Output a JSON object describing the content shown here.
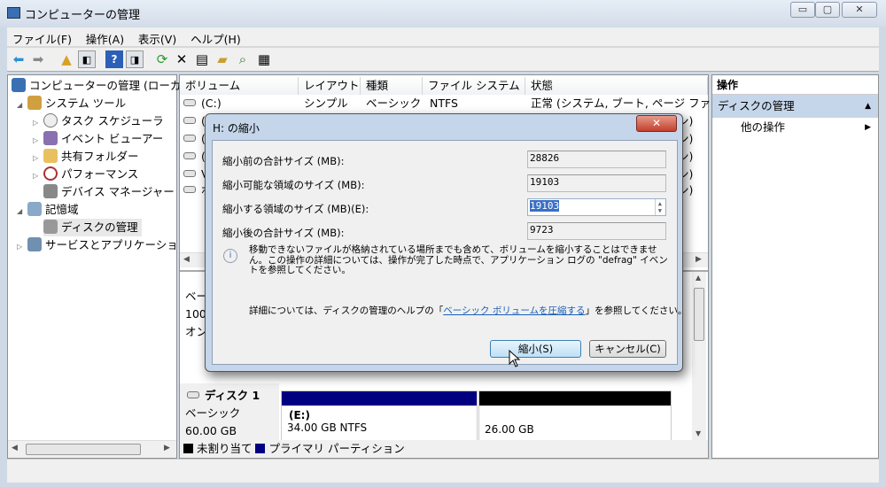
{
  "window": {
    "title": "コンピューターの管理",
    "minimize": "▭",
    "maximize": "▢",
    "close": "✕"
  },
  "menu": [
    "ファイル(F)",
    "操作(A)",
    "表示(V)",
    "ヘルプ(H)"
  ],
  "tree": [
    {
      "label": "コンピューターの管理 (ローカ",
      "expander": ""
    },
    {
      "label": "システム ツール",
      "expander": "◢"
    },
    {
      "label": "タスク スケジューラ",
      "expander": "▷"
    },
    {
      "label": "イベント ビューアー",
      "expander": "▷"
    },
    {
      "label": "共有フォルダー",
      "expander": "▷"
    },
    {
      "label": "パフォーマンス",
      "expander": "▷"
    },
    {
      "label": "デバイス マネージャー",
      "expander": ""
    },
    {
      "label": "記憶域",
      "expander": "◢"
    },
    {
      "label": "ディスクの管理",
      "expander": ""
    },
    {
      "label": "サービスとアプリケーショ",
      "expander": "▷"
    }
  ],
  "volumes": {
    "headers": [
      "ボリューム",
      "レイアウト",
      "種類",
      "ファイル システム",
      "状態"
    ],
    "rows": [
      {
        "volume": "(C:)",
        "layout": "シンプル",
        "type": "ベーシック",
        "fs": "NTFS",
        "status": "正常 (システム, ブート, ページ ファ"
      },
      {
        "volume": "(",
        "status": "ン)"
      },
      {
        "volume": "(",
        "status": "ン)"
      },
      {
        "volume": "(",
        "status": "ン)"
      },
      {
        "volume": "V",
        "status": "ン)"
      },
      {
        "volume": "ボ",
        "status": "ン)"
      }
    ]
  },
  "disk0": {
    "line1": "ベー",
    "line2": "100",
    "line3": "オン"
  },
  "disk1": {
    "name": "ディスク 1",
    "type": "ベーシック",
    "size": "60.00 GB",
    "partitions": [
      {
        "label": "(E:)",
        "detail": "34.00 GB NTFS",
        "color": "#000080"
      },
      {
        "label": "",
        "detail": "26.00 GB",
        "color": "#000000"
      }
    ]
  },
  "legend": [
    {
      "label": "未割り当て",
      "color": "#000000"
    },
    {
      "label": "プライマリ パーティション",
      "color": "#000080"
    }
  ],
  "actions": {
    "header": "操作",
    "section": "ディスクの管理",
    "item": "他の操作"
  },
  "dialog": {
    "title": "H: の縮小",
    "fields": [
      {
        "label": "縮小前の合計サイズ (MB):",
        "value": "28826"
      },
      {
        "label": "縮小可能な領域のサイズ (MB):",
        "value": "19103"
      },
      {
        "label": "縮小する領域のサイズ (MB)(E):",
        "value": "19103"
      },
      {
        "label": "縮小後の合計サイズ (MB):",
        "value": "9723"
      }
    ],
    "info": "移動できないファイルが格納されている場所までも含めて、ボリュームを縮小することはできません。この操作の詳細については、操作が完了した時点で、アプリケーション ログの \"defrag\" イベントを参照してください。",
    "help_prefix": "詳細については、ディスクの管理のヘルプの「",
    "help_link": "ベーシック ボリュームを圧縮する",
    "help_suffix": "」を参照してください。",
    "shrink": "縮小(S)",
    "cancel": "キャンセル(C)"
  }
}
